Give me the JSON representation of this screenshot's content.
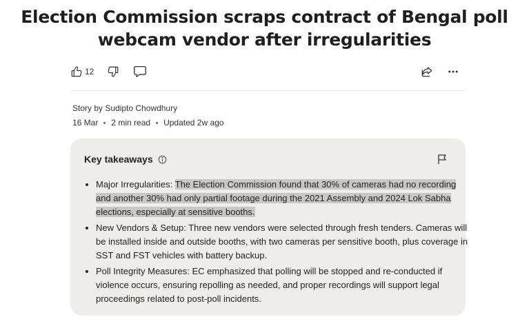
{
  "article": {
    "headline": "Election Commission scraps contract of Bengal poll webcam vendor after irregularities",
    "byline": "Story by Sudipto Chowdhury",
    "date": "16 Mar",
    "read_time": "2 min read",
    "updated": "Updated 2w ago"
  },
  "actions": {
    "like_count": "12",
    "icons": [
      "thumbs-up-icon",
      "thumbs-down-icon",
      "comment-icon",
      "share-icon",
      "more-icon"
    ]
  },
  "takeaways": {
    "title": "Key takeaways",
    "items": [
      {
        "label": "Major Irregularities: ",
        "text": "The Election Commission found that 30% of cameras had no recording and another 30% had only partial footage during the 2021 Assembly and 2024 Lok Sabha elections, especially at sensitive booths."
      },
      {
        "label": "New Vendors & Setup: ",
        "text": "Three new vendors were selected through fresh tenders. Cameras will be installed inside and outside booths, with two cameras per sensitive booth, plus coverage in SST and FST vehicles with battery backup."
      },
      {
        "label": "Poll Integrity Measures: ",
        "text": "EC emphasized that polling will be stopped and re-conducted if violence occurs, ensuring repolling as needed, and proper recordings will support legal proceedings related to post-poll incidents."
      }
    ]
  },
  "colors": {
    "card_bg": "#efedeb",
    "highlight": "#c9c7c4",
    "text": "#1f1f1f"
  }
}
